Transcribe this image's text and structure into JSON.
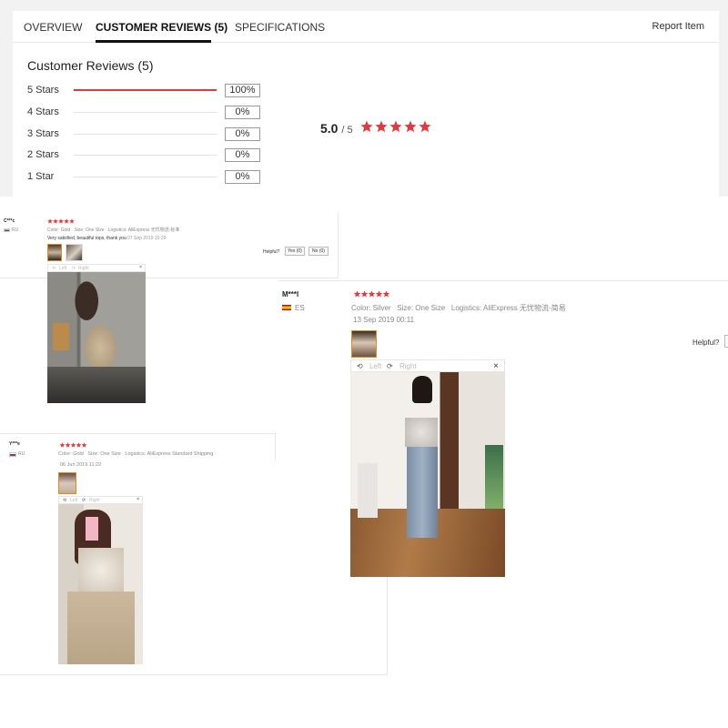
{
  "tabs": [
    {
      "label": "OVERVIEW"
    },
    {
      "label": "CUSTOMER REVIEWS (5)"
    },
    {
      "label": "SPECIFICATIONS"
    }
  ],
  "report_label": "Report Item",
  "reviews_title": "Customer Reviews (5)",
  "breakdown": [
    {
      "label": "5 Stars",
      "percent": "100%",
      "fraction": 1.0
    },
    {
      "label": "4 Stars",
      "percent": "0%",
      "fraction": 0
    },
    {
      "label": "3 Stars",
      "percent": "0%",
      "fraction": 0
    },
    {
      "label": "2 Stars",
      "percent": "0%",
      "fraction": 0
    },
    {
      "label": "1 Star",
      "percent": "0%",
      "fraction": 0
    }
  ],
  "average": {
    "score": "5.0",
    "out_of": "/ 5",
    "stars": 5
  },
  "colors": {
    "accent": "#e4393c",
    "tab_active": "#111111",
    "thumb_selected": "#e08a1e"
  },
  "icons": [
    "star-icon",
    "rotate-left-icon",
    "rotate-right-icon",
    "close-icon",
    "flag-icon"
  ],
  "reviews": [
    {
      "name": "C***c",
      "country": "RU",
      "stars": 5,
      "color_label": "Color:",
      "color": "Gold",
      "size_label": "Size:",
      "size": "One Size",
      "logistics_label": "Logistics:",
      "logistics": "AliExpress 无忧物流-标准",
      "text": "Very satisfied, beautiful tops, thank you",
      "date": "07 Sep 2019 10:39",
      "helpful_label": "Helpful?",
      "yes": "Yes (0)",
      "no": "No (0)",
      "viewer_left": "Left",
      "viewer_right": "Right",
      "close": "×"
    },
    {
      "name": "M***l",
      "country": "ES",
      "stars": 5,
      "color_label": "Color:",
      "color": "Silver",
      "size_label": "Size:",
      "size": "One Size",
      "logistics_label": "Logistics:",
      "logistics": "AliExpress 无忧物流-简易",
      "date": "13 Sep 2019 00:11",
      "helpful_label": "Helpful?",
      "viewer_left": "Left",
      "viewer_right": "Right",
      "close": "×"
    },
    {
      "name": "Y***e",
      "country": "RU",
      "stars": 5,
      "color_label": "Color:",
      "color": "Gold",
      "size_label": "Size:",
      "size": "One Size",
      "logistics_label": "Logistics:",
      "logistics": "AliExpress Standard Shipping",
      "date": "06 Jun 2019 11:22",
      "viewer_left": "Left",
      "viewer_right": "Right",
      "close": "×"
    }
  ]
}
